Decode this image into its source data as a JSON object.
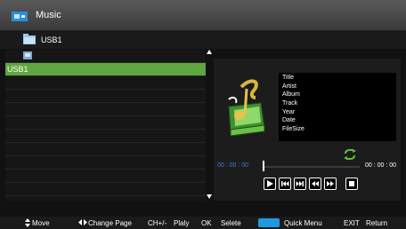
{
  "window": {
    "title": "Music"
  },
  "path": {
    "label": "USB1"
  },
  "filelist": {
    "selected_label": "USB1",
    "row_count": 11
  },
  "track_info": {
    "fields": [
      "Title",
      "Artist",
      "Album",
      "Track",
      "Year",
      "Date",
      "FileSize"
    ]
  },
  "player": {
    "current_time": "00 : 00 : 00",
    "total_time": "00 : 00 : 00",
    "progress": 0
  },
  "controls": [
    "play-pause",
    "previous",
    "next",
    "rewind",
    "fast-forward",
    "stop"
  ],
  "hints": {
    "move": "Move",
    "change_page": "Change Page",
    "ch": "CH+/-",
    "ch_action": "Plaly",
    "ok": "OK",
    "ok_action": "Selete",
    "quick_menu": "Quick Menu",
    "exit": "EXIT",
    "exit_action": "Return"
  },
  "colors": {
    "selection": "#5fa640",
    "accent_blue": "#1e9be0",
    "time_current": "#3a7fd5"
  }
}
